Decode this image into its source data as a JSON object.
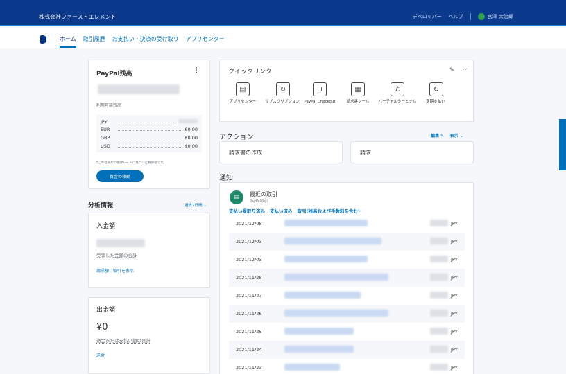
{
  "header": {
    "company": "株式会社ファーストエレメント",
    "developer": "デベロッパー",
    "help": "ヘルプ",
    "user": "宮澤 大治郎"
  },
  "nav": [
    "ホーム",
    "取引履歴",
    "お支払い・決済の受け取り",
    "アプリセンター"
  ],
  "balance": {
    "title": "PayPal残高",
    "available_label": "利用可能残高",
    "currencies": [
      {
        "cur": "JPY",
        "amt": ""
      },
      {
        "cur": "EUR",
        "amt": "€0.00"
      },
      {
        "cur": "GBP",
        "amt": "£0.00"
      },
      {
        "cur": "USD",
        "amt": "$0.00"
      }
    ],
    "note": "*これは最新の換算レートに基づいた概算額です。",
    "transfer_button": "資金の移動"
  },
  "analytics": {
    "title": "分析情報",
    "period": "過去7日間",
    "incoming": {
      "title": "入金額",
      "caption": "受領した金額の合計",
      "links": [
        "請求額",
        "取引を表示"
      ]
    },
    "outgoing": {
      "title": "出金額",
      "value": "¥0",
      "caption": "送金または支払い額の合計",
      "link": "送金"
    }
  },
  "quicklinks": {
    "title": "クイックリンク",
    "items": [
      {
        "label": "アプリセンター",
        "icon": "register-icon"
      },
      {
        "label": "サブスクリプション",
        "icon": "refresh-icon"
      },
      {
        "label": "PayPal Checkout",
        "icon": "cart-icon"
      },
      {
        "label": "請求書ツール",
        "icon": "invoice-icon"
      },
      {
        "label": "バーチャルターミナル",
        "icon": "phone-icon"
      },
      {
        "label": "定期支払い",
        "icon": "recurring-icon"
      }
    ]
  },
  "actions": {
    "title": "アクション",
    "edit": "編集",
    "view": "表示",
    "items": [
      "請求書の作成",
      "請求"
    ]
  },
  "notifications": {
    "title": "通知",
    "recent_title": "最近の取引",
    "recent_sub": "PayPal取引",
    "tabs": [
      "支払い受取り済み",
      "支払い済み",
      "取引(残高および手数料を含む)"
    ],
    "rows": [
      {
        "date": "2021/12/08",
        "currency": "JPY"
      },
      {
        "date": "2021/12/03",
        "currency": "JPY"
      },
      {
        "date": "2021/12/03",
        "currency": "JPY"
      },
      {
        "date": "2021/11/28",
        "currency": "JPY"
      },
      {
        "date": "2021/11/27",
        "currency": "JPY"
      },
      {
        "date": "2021/11/26",
        "currency": "JPY"
      },
      {
        "date": "2021/11/25",
        "currency": "JPY"
      },
      {
        "date": "2021/11/24",
        "currency": "JPY"
      },
      {
        "date": "2021/11/23",
        "currency": "JPY"
      }
    ]
  },
  "colors": {
    "topbar": "#0b3a8c",
    "accent": "#0070ba"
  }
}
